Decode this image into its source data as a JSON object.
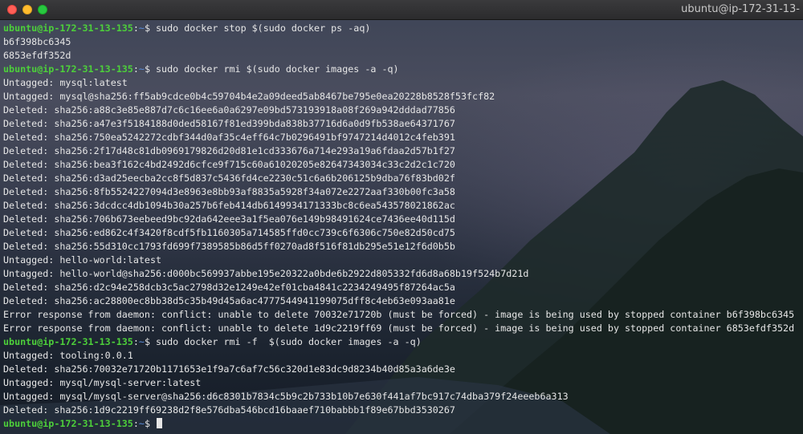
{
  "window": {
    "title": "ubuntu@ip-172-31-13-"
  },
  "terminal": {
    "lines": [
      {
        "type": "prompt",
        "user": "ubuntu@ip-172-31-13-135",
        "sep": ":",
        "path": "~",
        "sym": "$ ",
        "cmd": "sudo docker stop $(sudo docker ps -aq)"
      },
      {
        "type": "out",
        "text": "b6f398bc6345"
      },
      {
        "type": "out",
        "text": "6853efdf352d"
      },
      {
        "type": "prompt",
        "user": "ubuntu@ip-172-31-13-135",
        "sep": ":",
        "path": "~",
        "sym": "$ ",
        "cmd": "sudo docker rmi $(sudo docker images -a -q)"
      },
      {
        "type": "out",
        "text": "Untagged: mysql:latest"
      },
      {
        "type": "out",
        "text": "Untagged: mysql@sha256:ff5ab9cdce0b4c59704b4e2a09deed5ab8467be795e0ea20228b8528f53fcf82"
      },
      {
        "type": "out",
        "text": "Deleted: sha256:a88c3e85e887d7c6c16ee6a0a6297e09bd573193918a08f269a942dddad77856"
      },
      {
        "type": "out",
        "text": "Deleted: sha256:a47e3f5184188d0ded58167f81ed399bda838b37716d6a0d9fb538ae64371767"
      },
      {
        "type": "out",
        "text": "Deleted: sha256:750ea5242272cdbf344d0af35c4eff64c7b0296491bf9747214d4012c4feb391"
      },
      {
        "type": "out",
        "text": "Deleted: sha256:2f17d48c81db0969179826d20d81e1cd333676a714e293a19a6fdaa2d57b1f27"
      },
      {
        "type": "out",
        "text": "Deleted: sha256:bea3f162c4bd2492d6cfce9f715c60a61020205e82647343034c33c2d2c1c720"
      },
      {
        "type": "out",
        "text": "Deleted: sha256:d3ad25eecba2cc8f5d837c5436fd4ce2230c51c6a6b206125b9dba76f83bd02f"
      },
      {
        "type": "out",
        "text": "Deleted: sha256:8fb5524227094d3e8963e8bb93af8835a5928f34a072e2272aaf330b00fc3a58"
      },
      {
        "type": "out",
        "text": "Deleted: sha256:3dcdcc4db1094b30a257b6feb414db6149934171333bc8c6ea543578021862ac"
      },
      {
        "type": "out",
        "text": "Deleted: sha256:706b673eebeed9bc92da642eee3a1f5ea076e149b98491624ce7436ee40d115d"
      },
      {
        "type": "out",
        "text": "Deleted: sha256:ed862c4f3420f8cdf5fb1160305a714585ffd0cc739c6f6306c750e82d50cd75"
      },
      {
        "type": "out",
        "text": "Deleted: sha256:55d310cc1793fd699f7389585b86d5ff0270ad8f516f81db295e51e12f6d0b5b"
      },
      {
        "type": "out",
        "text": "Untagged: hello-world:latest"
      },
      {
        "type": "out",
        "text": "Untagged: hello-world@sha256:d000bc569937abbe195e20322a0bde6b2922d805332fd6d8a68b19f524b7d21d"
      },
      {
        "type": "out",
        "text": "Deleted: sha256:d2c94e258dcb3c5ac2798d32e1249e42ef01cba4841c2234249495f87264ac5a"
      },
      {
        "type": "out",
        "text": "Deleted: sha256:ac28800ec8bb38d5c35b49d45a6ac4777544941199075dff8c4eb63e093aa81e"
      },
      {
        "type": "out",
        "text": "Error response from daemon: conflict: unable to delete 70032e71720b (must be forced) - image is being used by stopped container b6f398bc6345"
      },
      {
        "type": "out",
        "text": "Error response from daemon: conflict: unable to delete 1d9c2219ff69 (must be forced) - image is being used by stopped container 6853efdf352d"
      },
      {
        "type": "prompt",
        "user": "ubuntu@ip-172-31-13-135",
        "sep": ":",
        "path": "~",
        "sym": "$ ",
        "cmd": "sudo docker rmi -f  $(sudo docker images -a -q)"
      },
      {
        "type": "out",
        "text": "Untagged: tooling:0.0.1"
      },
      {
        "type": "out",
        "text": "Deleted: sha256:70032e71720b1171653e1f9a7c6af7c56c320d1e83dc9d8234b40d85a3a6de3e"
      },
      {
        "type": "out",
        "text": "Untagged: mysql/mysql-server:latest"
      },
      {
        "type": "out",
        "text": "Untagged: mysql/mysql-server@sha256:d6c8301b7834c5b9c2b733b10b7e630f441af7bc917c74dba379f24eeeb6a313"
      },
      {
        "type": "out",
        "text": "Deleted: sha256:1d9c2219ff69238d2f8e576dba546bcd16baaef710babbb1f89e67bbd3530267"
      },
      {
        "type": "prompt",
        "user": "ubuntu@ip-172-31-13-135",
        "sep": ":",
        "path": "~",
        "sym": "$ ",
        "cmd": "",
        "cursor": true
      }
    ]
  }
}
